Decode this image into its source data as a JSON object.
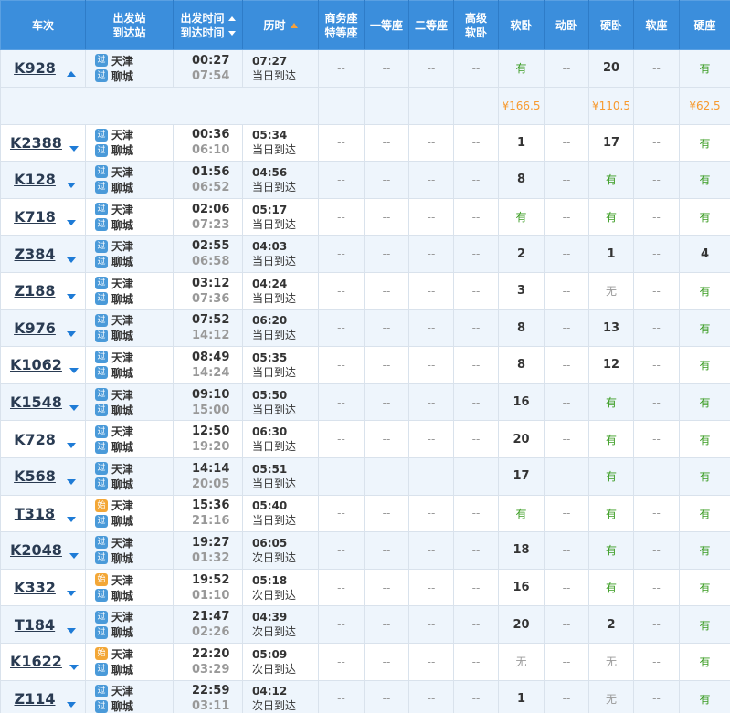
{
  "header": {
    "train": "车次",
    "stations_line1": "出发站",
    "stations_line2": "到达站",
    "times_line1": "出发时间",
    "times_line2": "到达时间",
    "duration": "历时",
    "business_line1": "商务座",
    "business_line2": "特等座",
    "first": "一等座",
    "second": "二等座",
    "adv_soft_line1": "高级",
    "adv_soft_line2": "软卧",
    "soft_sleeper": "软卧",
    "moving_sleeper": "动卧",
    "hard_sleeper": "硬卧",
    "soft_seat": "软座",
    "hard_seat": "硬座"
  },
  "badges": {
    "pass": "过",
    "start": "始"
  },
  "colors": {
    "header_bg": "#3b8edc",
    "have": "#3a9c22",
    "price": "#f79a2f",
    "row_alt": "#eef5fc"
  },
  "trains": [
    {
      "no": "K928",
      "expanded": true,
      "from_badge": "过",
      "from": "天津",
      "to_badge": "过",
      "to": "聊城",
      "dep": "00:27",
      "arr": "07:54",
      "dur": "07:27",
      "note": "当日到达",
      "seats": [
        "--",
        "--",
        "--",
        "--",
        "有",
        "--",
        "20",
        "--",
        "有"
      ],
      "prices": [
        "",
        "",
        "",
        "",
        "¥166.5",
        "",
        "¥110.5",
        "",
        "¥62.5"
      ]
    },
    {
      "no": "K2388",
      "from_badge": "过",
      "from": "天津",
      "to_badge": "过",
      "to": "聊城",
      "dep": "00:36",
      "arr": "06:10",
      "dur": "05:34",
      "note": "当日到达",
      "seats": [
        "--",
        "--",
        "--",
        "--",
        "1",
        "--",
        "17",
        "--",
        "有"
      ]
    },
    {
      "no": "K128",
      "from_badge": "过",
      "from": "天津",
      "to_badge": "过",
      "to": "聊城",
      "dep": "01:56",
      "arr": "06:52",
      "dur": "04:56",
      "note": "当日到达",
      "seats": [
        "--",
        "--",
        "--",
        "--",
        "8",
        "--",
        "有",
        "--",
        "有"
      ]
    },
    {
      "no": "K718",
      "from_badge": "过",
      "from": "天津",
      "to_badge": "过",
      "to": "聊城",
      "dep": "02:06",
      "arr": "07:23",
      "dur": "05:17",
      "note": "当日到达",
      "seats": [
        "--",
        "--",
        "--",
        "--",
        "有",
        "--",
        "有",
        "--",
        "有"
      ]
    },
    {
      "no": "Z384",
      "from_badge": "过",
      "from": "天津",
      "to_badge": "过",
      "to": "聊城",
      "dep": "02:55",
      "arr": "06:58",
      "dur": "04:03",
      "note": "当日到达",
      "seats": [
        "--",
        "--",
        "--",
        "--",
        "2",
        "--",
        "1",
        "--",
        "4"
      ]
    },
    {
      "no": "Z188",
      "from_badge": "过",
      "from": "天津",
      "to_badge": "过",
      "to": "聊城",
      "dep": "03:12",
      "arr": "07:36",
      "dur": "04:24",
      "note": "当日到达",
      "seats": [
        "--",
        "--",
        "--",
        "--",
        "3",
        "--",
        "无",
        "--",
        "有"
      ]
    },
    {
      "no": "K976",
      "from_badge": "过",
      "from": "天津",
      "to_badge": "过",
      "to": "聊城",
      "dep": "07:52",
      "arr": "14:12",
      "dur": "06:20",
      "note": "当日到达",
      "seats": [
        "--",
        "--",
        "--",
        "--",
        "8",
        "--",
        "13",
        "--",
        "有"
      ]
    },
    {
      "no": "K1062",
      "from_badge": "过",
      "from": "天津",
      "to_badge": "过",
      "to": "聊城",
      "dep": "08:49",
      "arr": "14:24",
      "dur": "05:35",
      "note": "当日到达",
      "seats": [
        "--",
        "--",
        "--",
        "--",
        "8",
        "--",
        "12",
        "--",
        "有"
      ]
    },
    {
      "no": "K1548",
      "from_badge": "过",
      "from": "天津",
      "to_badge": "过",
      "to": "聊城",
      "dep": "09:10",
      "arr": "15:00",
      "dur": "05:50",
      "note": "当日到达",
      "seats": [
        "--",
        "--",
        "--",
        "--",
        "16",
        "--",
        "有",
        "--",
        "有"
      ]
    },
    {
      "no": "K728",
      "from_badge": "过",
      "from": "天津",
      "to_badge": "过",
      "to": "聊城",
      "dep": "12:50",
      "arr": "19:20",
      "dur": "06:30",
      "note": "当日到达",
      "seats": [
        "--",
        "--",
        "--",
        "--",
        "20",
        "--",
        "有",
        "--",
        "有"
      ]
    },
    {
      "no": "K568",
      "from_badge": "过",
      "from": "天津",
      "to_badge": "过",
      "to": "聊城",
      "dep": "14:14",
      "arr": "20:05",
      "dur": "05:51",
      "note": "当日到达",
      "seats": [
        "--",
        "--",
        "--",
        "--",
        "17",
        "--",
        "有",
        "--",
        "有"
      ]
    },
    {
      "no": "T318",
      "from_badge": "始",
      "from": "天津",
      "to_badge": "过",
      "to": "聊城",
      "dep": "15:36",
      "arr": "21:16",
      "dur": "05:40",
      "note": "当日到达",
      "seats": [
        "--",
        "--",
        "--",
        "--",
        "有",
        "--",
        "有",
        "--",
        "有"
      ]
    },
    {
      "no": "K2048",
      "from_badge": "过",
      "from": "天津",
      "to_badge": "过",
      "to": "聊城",
      "dep": "19:27",
      "arr": "01:32",
      "dur": "06:05",
      "note": "次日到达",
      "seats": [
        "--",
        "--",
        "--",
        "--",
        "18",
        "--",
        "有",
        "--",
        "有"
      ]
    },
    {
      "no": "K332",
      "from_badge": "始",
      "from": "天津",
      "to_badge": "过",
      "to": "聊城",
      "dep": "19:52",
      "arr": "01:10",
      "dur": "05:18",
      "note": "次日到达",
      "seats": [
        "--",
        "--",
        "--",
        "--",
        "16",
        "--",
        "有",
        "--",
        "有"
      ]
    },
    {
      "no": "T184",
      "from_badge": "过",
      "from": "天津",
      "to_badge": "过",
      "to": "聊城",
      "dep": "21:47",
      "arr": "02:26",
      "dur": "04:39",
      "note": "次日到达",
      "seats": [
        "--",
        "--",
        "--",
        "--",
        "20",
        "--",
        "2",
        "--",
        "有"
      ]
    },
    {
      "no": "K1622",
      "from_badge": "始",
      "from": "天津",
      "to_badge": "过",
      "to": "聊城",
      "dep": "22:20",
      "arr": "03:29",
      "dur": "05:09",
      "note": "次日到达",
      "seats": [
        "--",
        "--",
        "--",
        "--",
        "无",
        "--",
        "无",
        "--",
        "有"
      ]
    },
    {
      "no": "Z114",
      "from_badge": "过",
      "from": "天津",
      "to_badge": "过",
      "to": "聊城",
      "dep": "22:59",
      "arr": "03:11",
      "dur": "04:12",
      "note": "次日到达",
      "seats": [
        "--",
        "--",
        "--",
        "--",
        "1",
        "--",
        "无",
        "--",
        "有"
      ]
    }
  ]
}
